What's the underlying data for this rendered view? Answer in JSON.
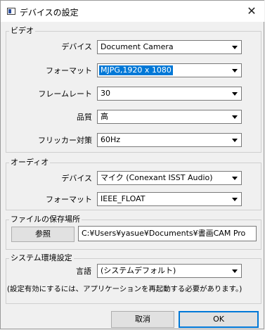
{
  "window": {
    "title": "デバイスの設定",
    "close_glyph": "✕"
  },
  "video": {
    "group_label": "ビデオ",
    "device_label": "デバイス",
    "device_value": "Document Camera",
    "format_label": "フォーマット",
    "format_value": "MJPG,1920 x 1080",
    "framerate_label": "フレームレート",
    "framerate_value": "30",
    "quality_label": "品質",
    "quality_value": "高",
    "flicker_label": "フリッカー対策",
    "flicker_value": "60Hz"
  },
  "audio": {
    "group_label": "オーディオ",
    "device_label": "デバイス",
    "device_value": "マイク (Conexant ISST Audio)",
    "format_label": "フォーマット",
    "format_value": "IEEE_FLOAT"
  },
  "save": {
    "group_label": "ファイルの保存場所",
    "browse_label": "参照",
    "path_value": "C:¥Users¥yasue¥Documents¥書画CAM Pro"
  },
  "system": {
    "group_label": "システム環境設定",
    "language_label": "言語",
    "language_value": "(システムデフォルト)",
    "note": "(設定有効にするには、アプリケーションを再起動する必要があります。)"
  },
  "footer": {
    "cancel_label": "取消",
    "ok_label": "OK"
  },
  "colors": {
    "selection": "#0078d7",
    "default_button_border": "#0078d7"
  },
  "icons": {
    "app": "window-icon",
    "close": "close-icon",
    "dropdown": "chevron-down-icon"
  }
}
